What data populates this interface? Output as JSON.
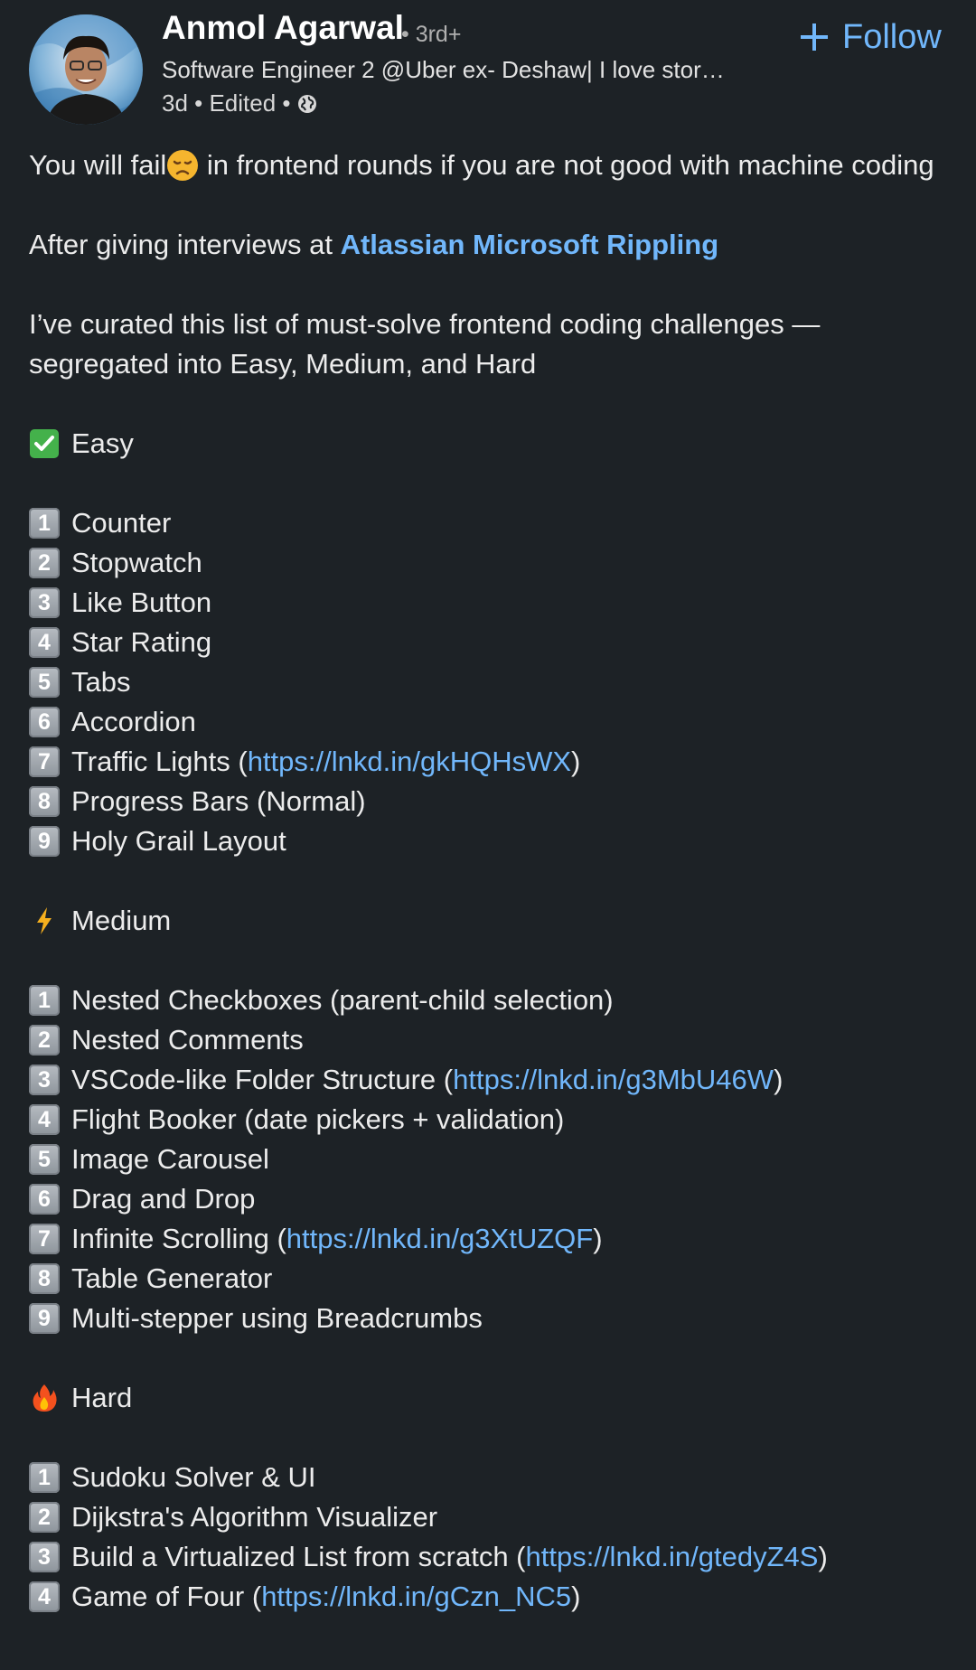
{
  "post": {
    "author": {
      "name": "Anmol Agarwal",
      "degree": "• 3rd+",
      "headline": "Software Engineer 2 @Uber ex- Deshaw| I love stor…",
      "meta": "3d • Edited •"
    },
    "follow_label": "Follow",
    "intro": {
      "part1": "You will fail",
      "part2": " in frontend rounds if you are not good with machine coding"
    },
    "interviews": {
      "prefix": "After giving interviews at ",
      "companies": "Atlassian Microsoft Rippling"
    },
    "curated": "I’ve curated this list of must-solve frontend coding challenges — segregated into Easy, Medium, and Hard",
    "sections": [
      {
        "heading": "Easy",
        "icon": "check-mark-icon",
        "items": [
          {
            "num": "1",
            "text": "Counter"
          },
          {
            "num": "2",
            "text": "Stopwatch"
          },
          {
            "num": "3",
            "text": "Like Button"
          },
          {
            "num": "4",
            "text": "Star Rating"
          },
          {
            "num": "5",
            "text": "Tabs"
          },
          {
            "num": "6",
            "text": "Accordion"
          },
          {
            "num": "7",
            "text": "Traffic Lights (",
            "link": "https://lnkd.in/gkHQHsWX",
            "suffix": ")"
          },
          {
            "num": "8",
            "text": "Progress Bars (Normal)"
          },
          {
            "num": "9",
            "text": "Holy Grail Layout"
          }
        ]
      },
      {
        "heading": "Medium",
        "icon": "lightning-icon",
        "items": [
          {
            "num": "1",
            "text": "Nested Checkboxes (parent-child selection)"
          },
          {
            "num": "2",
            "text": "Nested Comments"
          },
          {
            "num": "3",
            "text": "VSCode-like Folder Structure (",
            "link": "https://lnkd.in/g3MbU46W",
            "suffix": ")"
          },
          {
            "num": "4",
            "text": "Flight Booker (date pickers + validation)"
          },
          {
            "num": "5",
            "text": "Image Carousel"
          },
          {
            "num": "6",
            "text": "Drag and Drop"
          },
          {
            "num": "7",
            "text": "Infinite Scrolling (",
            "link": "https://lnkd.in/g3XtUZQF",
            "suffix": ")"
          },
          {
            "num": "8",
            "text": "Table Generator"
          },
          {
            "num": "9",
            "text": "Multi-stepper using Breadcrumbs"
          }
        ]
      },
      {
        "heading": "Hard",
        "icon": "fire-icon",
        "items": [
          {
            "num": "1",
            "text": "Sudoku Solver & UI"
          },
          {
            "num": "2",
            "text": "Dijkstra's Algorithm Visualizer"
          },
          {
            "num": "3",
            "text": "Build a Virtualized List from scratch (",
            "link": "https://lnkd.in/gtedyZ4S",
            "suffix": ")"
          },
          {
            "num": "4",
            "text": "Game of Four (",
            "link": "https://lnkd.in/gCzn_NC5",
            "suffix": ")"
          }
        ]
      }
    ]
  },
  "colors": {
    "background": "#1d2226",
    "link": "#71b7fb",
    "text": "#ececec"
  }
}
